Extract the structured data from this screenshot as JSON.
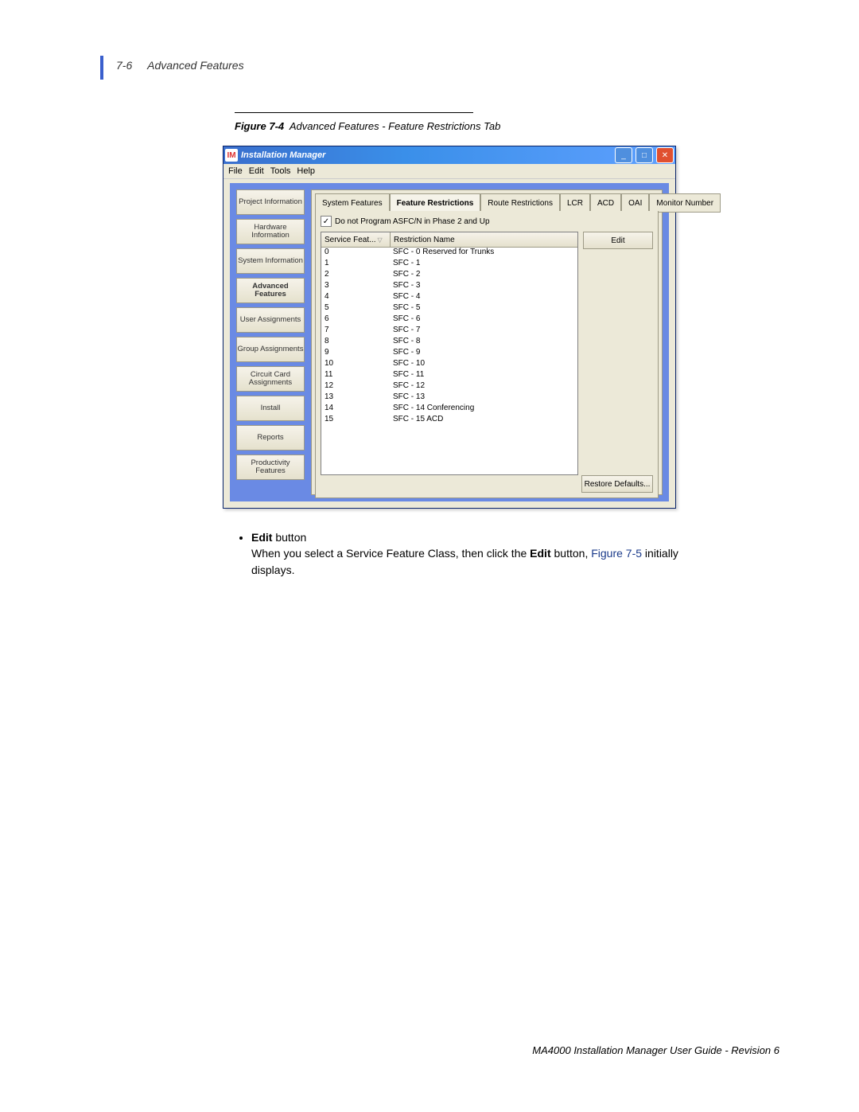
{
  "header": {
    "pageNum": "7-6",
    "section": "Advanced Features"
  },
  "figure": {
    "label": "Figure 7-4",
    "title": "Advanced Features - Feature Restrictions Tab"
  },
  "window": {
    "iconText": "IM",
    "title": "Installation Manager"
  },
  "menu": [
    "File",
    "Edit",
    "Tools",
    "Help"
  ],
  "sidebar": [
    "Project Information",
    "Hardware Information",
    "System Information",
    "Advanced Features",
    "User Assignments",
    "Group Assignments",
    "Circuit Card Assignments",
    "Install",
    "Reports",
    "Productivity Features"
  ],
  "tabs": [
    "System Features",
    "Feature Restrictions",
    "Route Restrictions",
    "LCR",
    "ACD",
    "OAI",
    "Monitor Number"
  ],
  "activeTab": 1,
  "checkbox": {
    "checked": true,
    "label": "Do not Program ASFC/N in Phase 2 and Up"
  },
  "columns": [
    "Service Feat...",
    "Restriction Name"
  ],
  "rows": [
    {
      "sf": "0",
      "name": "SFC - 0  Reserved for Trunks"
    },
    {
      "sf": "1",
      "name": "SFC - 1"
    },
    {
      "sf": "2",
      "name": "SFC - 2"
    },
    {
      "sf": "3",
      "name": "SFC - 3"
    },
    {
      "sf": "4",
      "name": "SFC - 4"
    },
    {
      "sf": "5",
      "name": "SFC - 5"
    },
    {
      "sf": "6",
      "name": "SFC - 6"
    },
    {
      "sf": "7",
      "name": "SFC - 7"
    },
    {
      "sf": "8",
      "name": "SFC - 8"
    },
    {
      "sf": "9",
      "name": "SFC - 9"
    },
    {
      "sf": "10",
      "name": "SFC - 10"
    },
    {
      "sf": "11",
      "name": "SFC - 11"
    },
    {
      "sf": "12",
      "name": "SFC - 12"
    },
    {
      "sf": "13",
      "name": "SFC - 13"
    },
    {
      "sf": "14",
      "name": "SFC - 14  Conferencing"
    },
    {
      "sf": "15",
      "name": "SFC - 15  ACD"
    }
  ],
  "buttons": {
    "edit": "Edit",
    "restore": "Restore Defaults..."
  },
  "body": {
    "bullet": "Edit",
    "bulletSuffix": " button",
    "line1a": "When you select a Service Feature Class, then click the ",
    "line1b": "Edit",
    "line1c": " button, ",
    "link": "Figure 7-5",
    "line1d": " initially displays."
  },
  "footer": "MA4000 Installation Manager User Guide - Revision 6"
}
